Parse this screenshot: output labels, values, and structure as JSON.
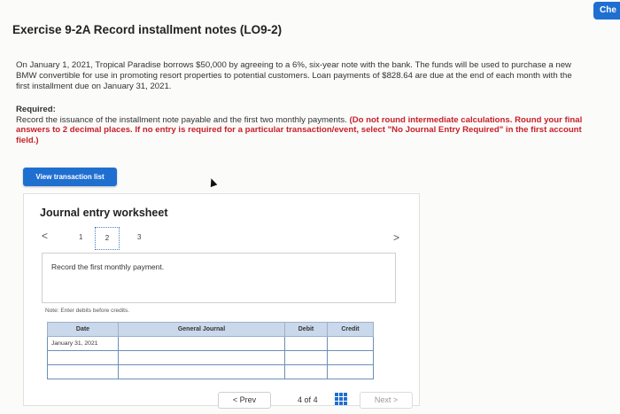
{
  "header": {
    "check_tab": "Che"
  },
  "exercise": {
    "title": "Exercise 9-2A Record installment notes (LO9-2)",
    "paragraph": "On January 1, 2021, Tropical Paradise borrows $50,000 by agreeing to a 6%, six-year note with the bank. The funds will be used to purchase a new BMW convertible for use in promoting resort properties to potential customers. Loan payments of $828.64 are due at the end of each month with the first installment due on January 31, 2021.",
    "required_label": "Required:",
    "required_text": "Record the issuance of the installment note payable and the first two monthly payments. ",
    "required_red": "(Do not round intermediate calculations. Round your final answers to 2 decimal places. If no entry is required for a particular transaction/event, select \"No Journal Entry Required\" in the first account field.)"
  },
  "view_button": {
    "label": "View transaction list"
  },
  "worksheet": {
    "title": "Journal entry worksheet",
    "prev_arrow": "<",
    "next_arrow": ">",
    "pages": [
      "1",
      "2",
      "3"
    ],
    "description": "Record the first monthly payment.",
    "note": "Note: Enter debits before credits.",
    "columns": [
      "Date",
      "General Journal",
      "Debit",
      "Credit"
    ],
    "rows": [
      [
        "January 31, 2021",
        "",
        "",
        ""
      ],
      [
        "",
        "",
        "",
        ""
      ],
      [
        "",
        "",
        "",
        ""
      ]
    ]
  },
  "nav": {
    "prev": "< Prev",
    "page_current": "4",
    "page_of": "of",
    "page_total": "4",
    "next": "Next >"
  },
  "colors": {
    "accent": "#1f6fd1",
    "required_red": "#c8202a",
    "table_header": "#c9d8ea"
  }
}
